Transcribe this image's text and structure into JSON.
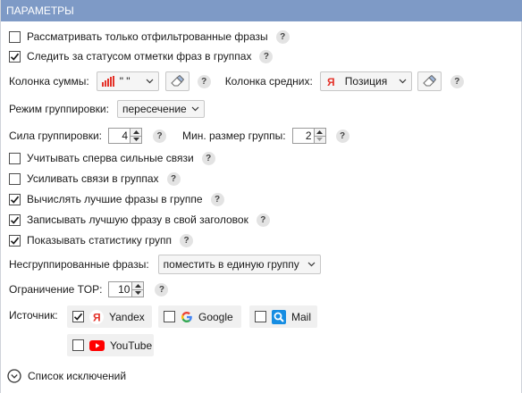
{
  "header": {
    "title": "ПАРАМЕТРЫ"
  },
  "options": {
    "filtered_only": {
      "label": "Рассматривать только отфильтрованные фразы",
      "checked": false
    },
    "track_status": {
      "label": "Следить за статусом отметки фраз в группах",
      "checked": true
    },
    "strong_first": {
      "label": "Учитывать сперва сильные связи",
      "checked": false
    },
    "strengthen": {
      "label": "Усиливать связи в группах",
      "checked": false
    },
    "best_phrases": {
      "label": "Вычислять лучшие фразы в группе",
      "checked": true
    },
    "write_best": {
      "label": "Записывать лучшую фразу в свой заголовок",
      "checked": true
    },
    "show_stats": {
      "label": "Показывать статистику групп",
      "checked": true
    }
  },
  "sum_column": {
    "label": "Колонка суммы:",
    "value": "\" \""
  },
  "avg_column": {
    "label": "Колонка средних:",
    "value": "Позиция"
  },
  "grouping_mode": {
    "label": "Режим группировки:",
    "value": "пересечение"
  },
  "grouping_strength": {
    "label": "Сила группировки:",
    "value": "4"
  },
  "min_group_size": {
    "label": "Мин. размер группы:",
    "value": "2"
  },
  "ungrouped": {
    "label": "Несгруппированные фразы:",
    "value": "поместить в единую группу"
  },
  "top_limit": {
    "label": "Ограничение TOP:",
    "value": "10"
  },
  "sources": {
    "label": "Источник:",
    "items": [
      {
        "name": "Yandex",
        "checked": true,
        "icon": "yandex-icon"
      },
      {
        "name": "Google",
        "checked": false,
        "icon": "google-icon"
      },
      {
        "name": "Mail",
        "checked": false,
        "icon": "mail-search-icon"
      },
      {
        "name": "YouTube",
        "checked": false,
        "icon": "youtube-icon"
      }
    ]
  },
  "exclusions": {
    "label": "Список исключений"
  },
  "help": {
    "symbol": "?"
  },
  "colors": {
    "header": "#7e9ac6",
    "yandex": "#e4332a",
    "youtube": "#ff0000",
    "mail": "#168de2"
  }
}
